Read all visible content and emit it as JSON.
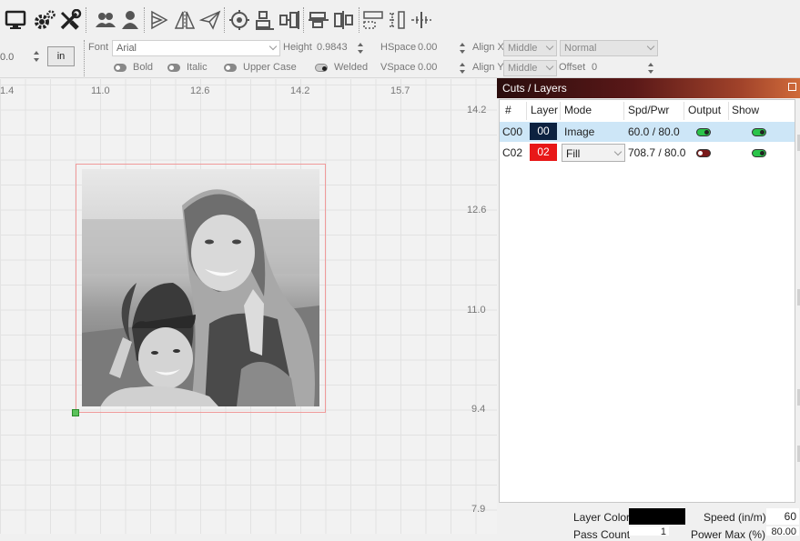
{
  "toolbar": {
    "icons": [
      "monitor-icon",
      "gear-icon",
      "wrench-icon",
      "users-icon",
      "user-icon",
      "flip-horizontal-icon",
      "mirror-icon",
      "send-icon",
      "target-icon",
      "align-icon",
      "distribute-icon",
      "align-center-icon",
      "distribute-center-icon",
      "resize-icon",
      "ruler-icon",
      "crosshair-icon"
    ]
  },
  "textbar": {
    "value_left": "0.0",
    "unit_button": "in",
    "font_label": "Font",
    "font_value": "Arial",
    "height_label": "Height",
    "height_value": "0.9843",
    "hspace_label": "HSpace",
    "hspace_value": "0.00",
    "alignx_label": "Align X",
    "alignx_value": "Middle",
    "style_value": "Normal",
    "bold_label": "Bold",
    "italic_label": "Italic",
    "uppercase_label": "Upper Case",
    "welded_label": "Welded",
    "vspace_label": "VSpace",
    "vspace_value": "0.00",
    "aligny_label": "Align Y",
    "aligny_value": "Middle",
    "offset_label": "Offset",
    "offset_value": "0"
  },
  "rulers": {
    "top": [
      "1.4",
      "11.0",
      "12.6",
      "14.2",
      "15.7"
    ],
    "right": [
      "14.2",
      "12.6",
      "11.0",
      "9.4",
      "7.9"
    ]
  },
  "panel": {
    "title": "Cuts / Layers",
    "headers": [
      "#",
      "Layer",
      "Mode",
      "Spd/Pwr",
      "Output",
      "Show"
    ],
    "rows": [
      {
        "id": "C00",
        "layer": "00",
        "layer_color": "#0d2240",
        "mode": "Image",
        "spdpwr": "60.0 / 80.0",
        "output": "on",
        "show": "on"
      },
      {
        "id": "C02",
        "layer": "02",
        "layer_color": "#e81818",
        "mode": "Fill",
        "spdpwr": "708.7 / 80.0",
        "output": "off",
        "show": "on"
      }
    ],
    "layer_color_label": "Layer Color",
    "layer_color_value": "#000000",
    "speed_label": "Speed (in/m)",
    "speed_value": "60",
    "pass_count_label": "Pass Count",
    "pass_count_value": "1",
    "power_max_label": "Power Max (%)",
    "power_max_value": "80.00"
  }
}
